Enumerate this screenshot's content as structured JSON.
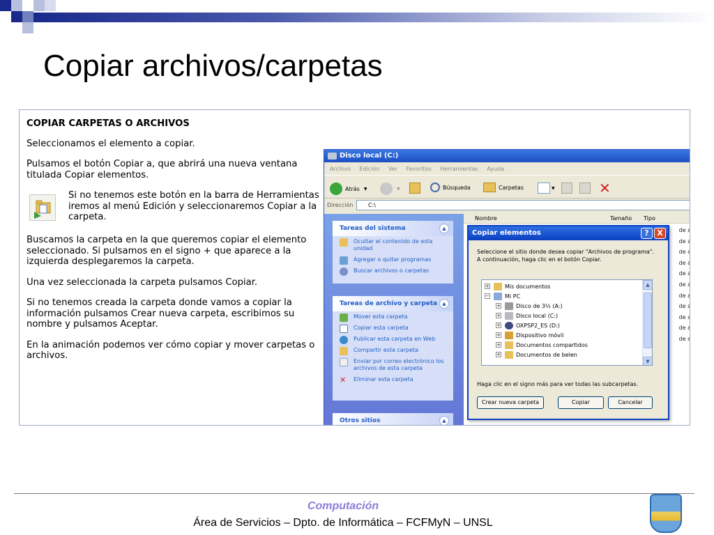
{
  "slide": {
    "title": "Copiar archivos/carpetas"
  },
  "instructions": {
    "heading": "COPIAR CARPETAS O ARCHIVOS",
    "p1": "Seleccionamos el elemento a copiar.",
    "p2": "Pulsamos el botón Copiar a, que abrirá una nueva ventana titulada Copiar elementos.",
    "tip": "Si no tenemos este botón en la barra de Herramientas iremos al menú Edición y seleccionaremos Copiar a la carpeta.",
    "p3": "Buscamos la carpeta en la que queremos copiar el elemento seleccionado. Si pulsamos en el signo + que aparece a la izquierda desplegaremos la carpeta.",
    "p4": "Una vez seleccionada la carpeta pulsamos Copiar.",
    "p5": "Si no tenemos creada la carpeta donde vamos a copiar la información pulsamos Crear nueva carpeta, escribimos su nombre y pulsamos Aceptar.",
    "p6": "En la animación podemos ver cómo copiar y mover carpetas o archivos."
  },
  "explorer": {
    "window_title": "Disco local (C:)",
    "menu": [
      "Archivo",
      "Edición",
      "Ver",
      "Favoritos",
      "Herramientas",
      "Ayuda"
    ],
    "toolbar": {
      "back": "Atrás",
      "search": "Búsqueda",
      "folders": "Carpetas"
    },
    "address_label": "Dirección",
    "address_value": "C:\\",
    "system_tasks": {
      "title": "Tareas del sistema",
      "items": [
        "Ocultar el contenido de esta unidad",
        "Agregar o quitar programas",
        "Buscar archivos o carpetas"
      ]
    },
    "file_tasks": {
      "title": "Tareas de archivo y carpeta",
      "items": [
        "Mover esta carpeta",
        "Copiar esta carpeta",
        "Publicar esta carpeta en Web",
        "Compartir esta carpeta",
        "Enviar por correo electrónico los archivos de esta carpeta",
        "Eliminar esta carpeta"
      ]
    },
    "other_places": {
      "title": "Otros sitios"
    },
    "columns": {
      "name": "Nombre",
      "size": "Tamaño",
      "type": "Tipo"
    },
    "type_cells": [
      "de a",
      "de a",
      "de a",
      "de a",
      "de a",
      "de a",
      "de a",
      "de a",
      "de a",
      "de a",
      "de a"
    ]
  },
  "dialog": {
    "title": "Copiar elementos",
    "help": "?",
    "close": "X",
    "description": "Seleccione el sitio donde desea copiar \"Archivos de programa\". A continuación, haga clic en el botón Copiar.",
    "tree": [
      "Mis documentos",
      "Mi PC",
      "Disco de 3½ (A:)",
      "Disco local (C:)",
      "OXPSP2_ES (D:)",
      "Dispositivo móvil",
      "Documentos compartidos",
      "Documentos de belen"
    ],
    "hint": "Haga clic en el signo más para ver todas las subcarpetas.",
    "btn_new": "Crear nueva carpeta",
    "btn_copy": "Copiar",
    "btn_cancel": "Cancelar"
  },
  "footer": {
    "line1": "Computación",
    "line2": "Área de Servicios – Dpto. de Informática – FCFMyN – UNSL"
  },
  "colors": {
    "title_bar": "#1b4fc4",
    "footer_accent": "#8a7fd8",
    "task_pane": "#d6dff7",
    "link": "#215dc6"
  }
}
